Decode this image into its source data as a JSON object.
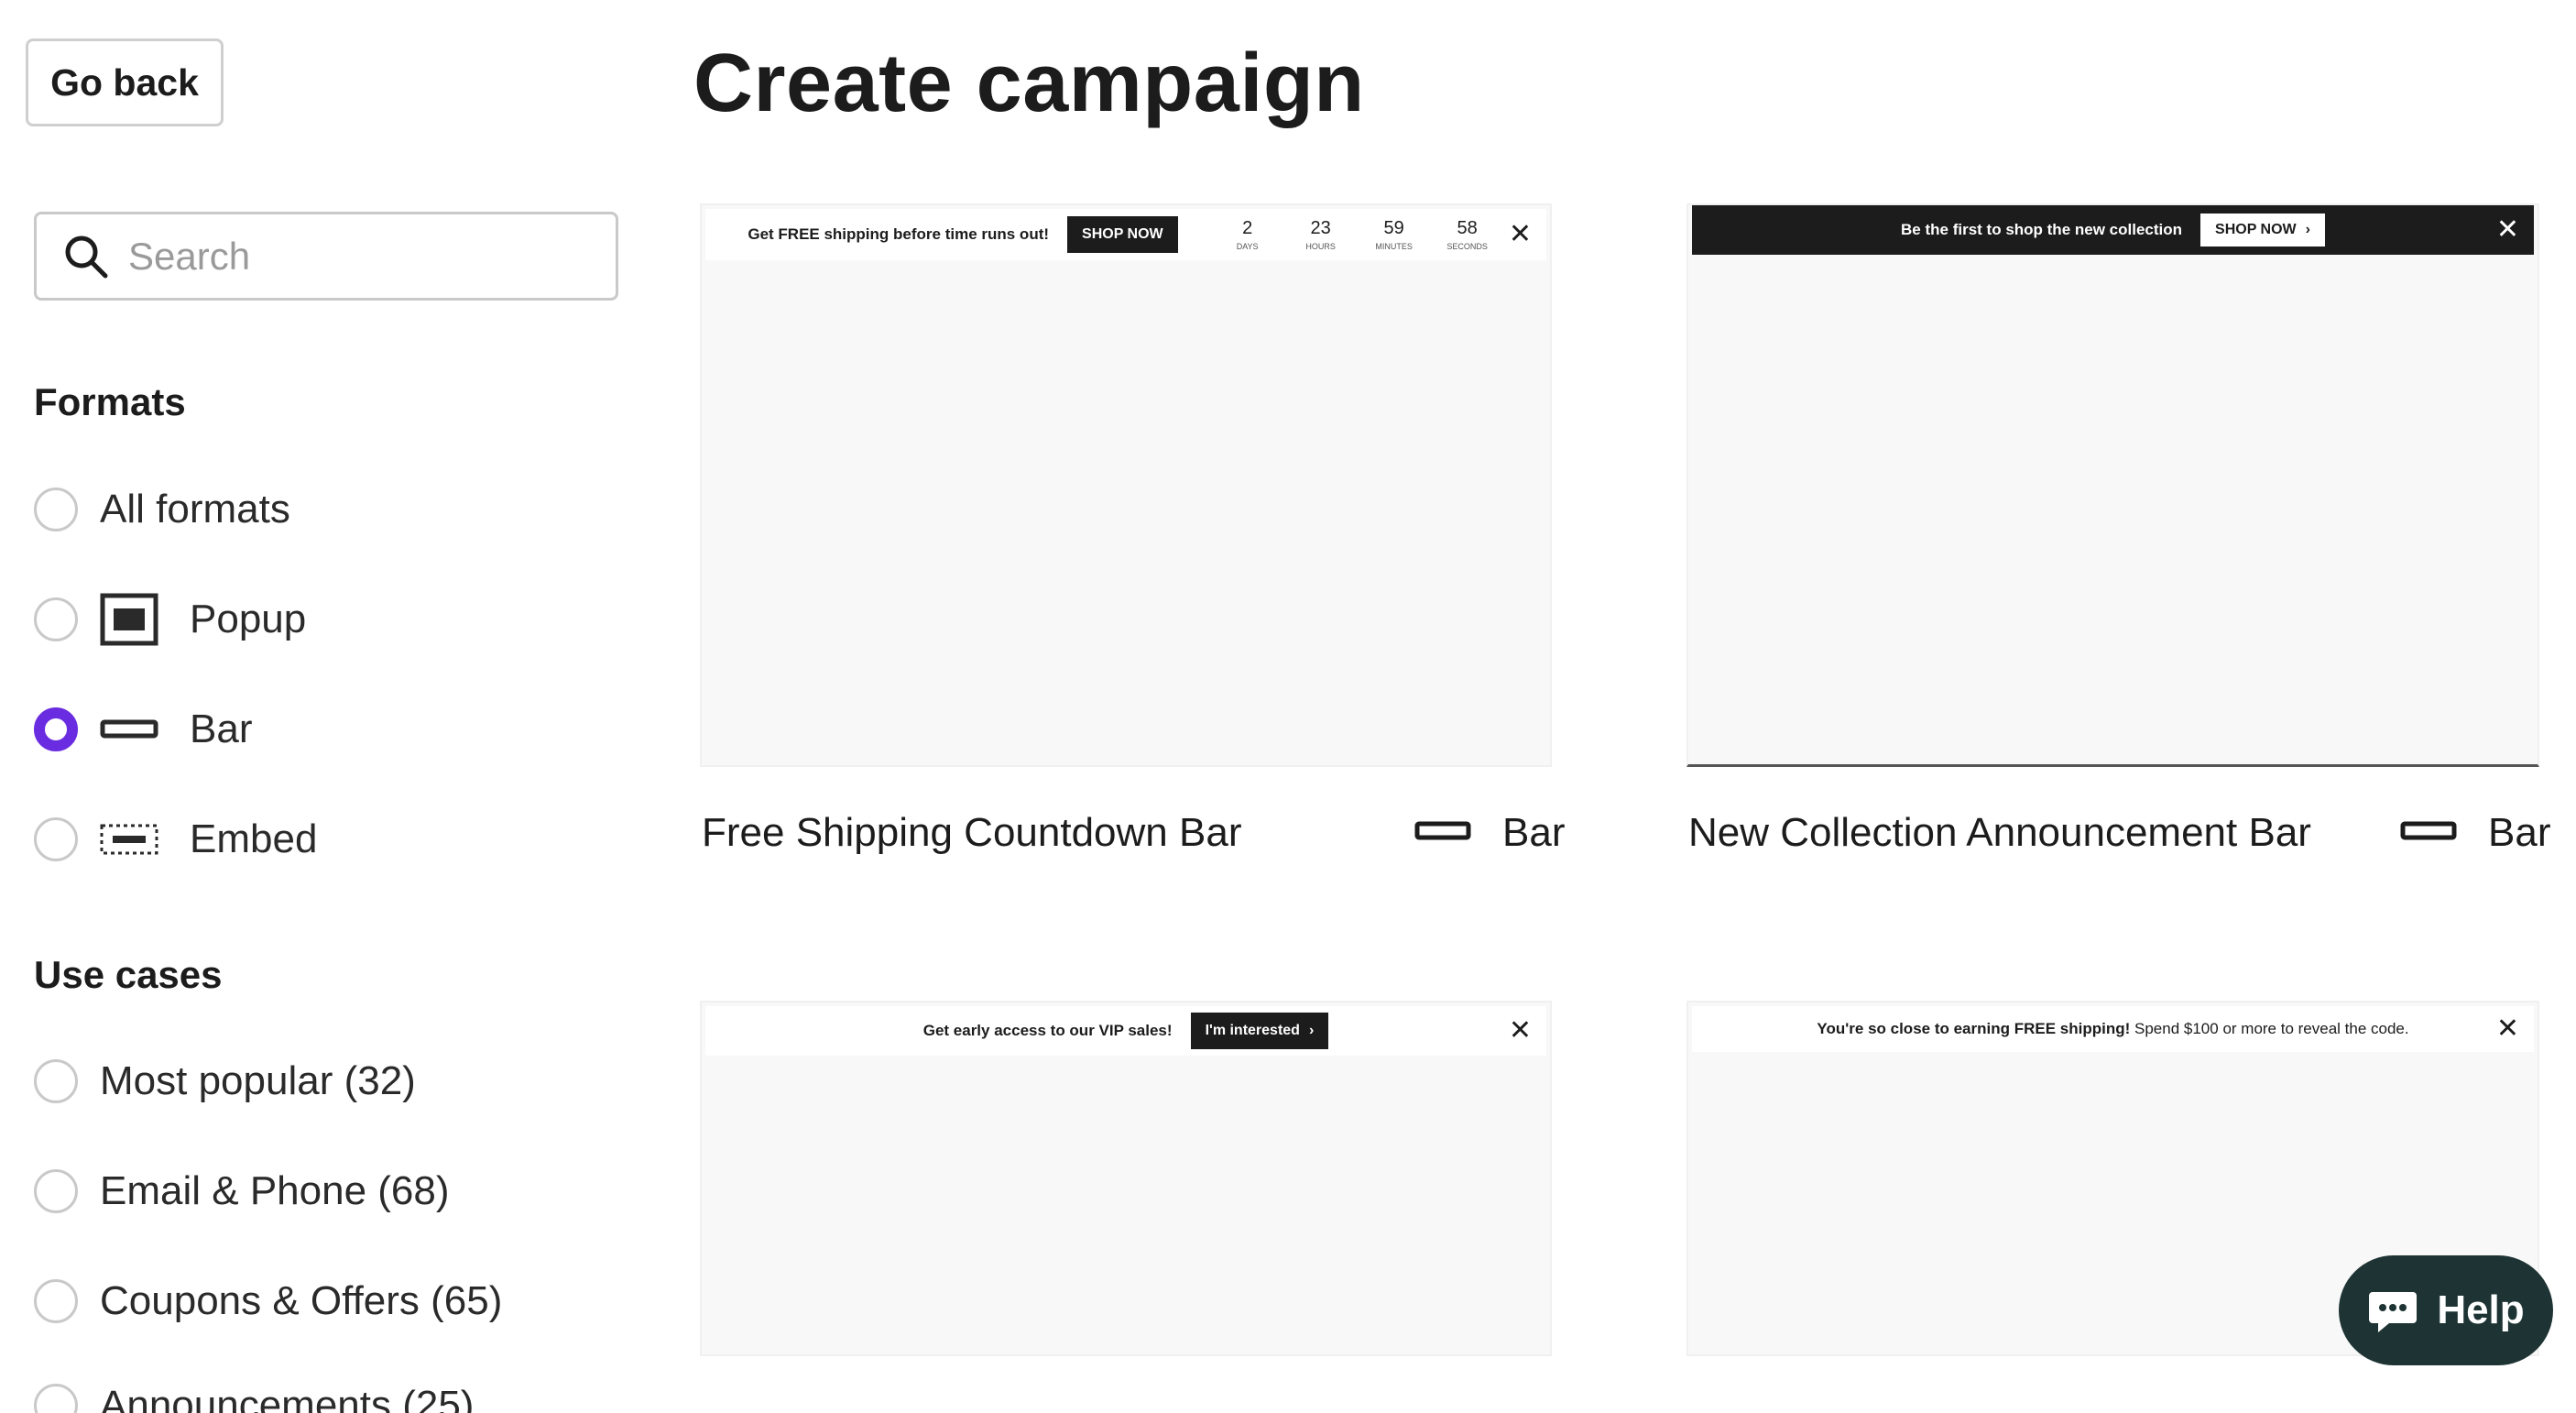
{
  "header": {
    "back_label": "Go back",
    "title": "Create campaign"
  },
  "search": {
    "placeholder": "Search",
    "value": ""
  },
  "formats": {
    "heading": "Formats",
    "selected": "Bar",
    "options": [
      {
        "label": "All formats",
        "icon": "",
        "checked": false
      },
      {
        "label": "Popup",
        "icon": "popup-format-icon",
        "checked": false
      },
      {
        "label": "Bar",
        "icon": "bar-format-icon",
        "checked": true
      },
      {
        "label": "Embed",
        "icon": "embed-format-icon",
        "checked": false
      }
    ]
  },
  "use_cases": {
    "heading": "Use cases",
    "options": [
      {
        "label": "Most popular (32)",
        "checked": false
      },
      {
        "label": "Email & Phone (68)",
        "checked": false
      },
      {
        "label": "Coupons & Offers (65)",
        "checked": false
      },
      {
        "label": "Announcements (25)",
        "checked": false
      }
    ]
  },
  "templates": [
    {
      "title": "Free Shipping Countdown Bar",
      "type": "Bar",
      "preview": {
        "text": "Get FREE shipping before time runs out!",
        "button": "SHOP NOW",
        "countdown": [
          {
            "value": "2",
            "label": "DAYS"
          },
          {
            "value": "23",
            "label": "HOURS"
          },
          {
            "value": "59",
            "label": "MINUTES"
          },
          {
            "value": "58",
            "label": "SECONDS"
          }
        ],
        "close": "✕"
      }
    },
    {
      "title": "New Collection Announcement Bar",
      "type": "Bar",
      "preview": {
        "text": "Be the first to shop the new collection",
        "button": "SHOP NOW",
        "chevron": "›",
        "close": "✕"
      }
    },
    {
      "title": "",
      "type": "Bar",
      "preview": {
        "text": "Get early access to our VIP sales!",
        "button": "I'm interested",
        "chevron": "›",
        "close": "✕"
      }
    },
    {
      "title": "",
      "type": "Bar",
      "preview": {
        "text_bold": "You're so close to earning FREE shipping!",
        "text_normal": "Spend $100 or more to reveal the code.",
        "close": "✕"
      }
    }
  ],
  "help": {
    "label": "Help"
  },
  "colors": {
    "accent": "#6a2ce0",
    "dark": "#1c1c1c",
    "help_bg": "#1e3333",
    "preview_bg": "#f8f8f8"
  }
}
